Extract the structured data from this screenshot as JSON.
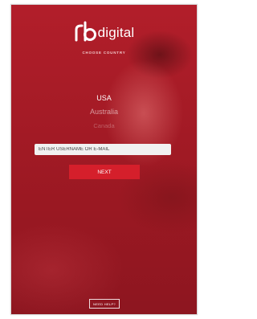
{
  "brand": {
    "logo_text": "digital",
    "logo_mark": "rb",
    "accent_color": "#d51f2b"
  },
  "country_label": "CHOOSE COUNTRY",
  "countries": [
    "USA",
    "Australia",
    "Canada"
  ],
  "selected_country": "USA",
  "username": {
    "placeholder": "ENTER USERNAME OR E-MAIL",
    "value": ""
  },
  "next_label": "NEXT",
  "help_label": "NEED HELP?"
}
